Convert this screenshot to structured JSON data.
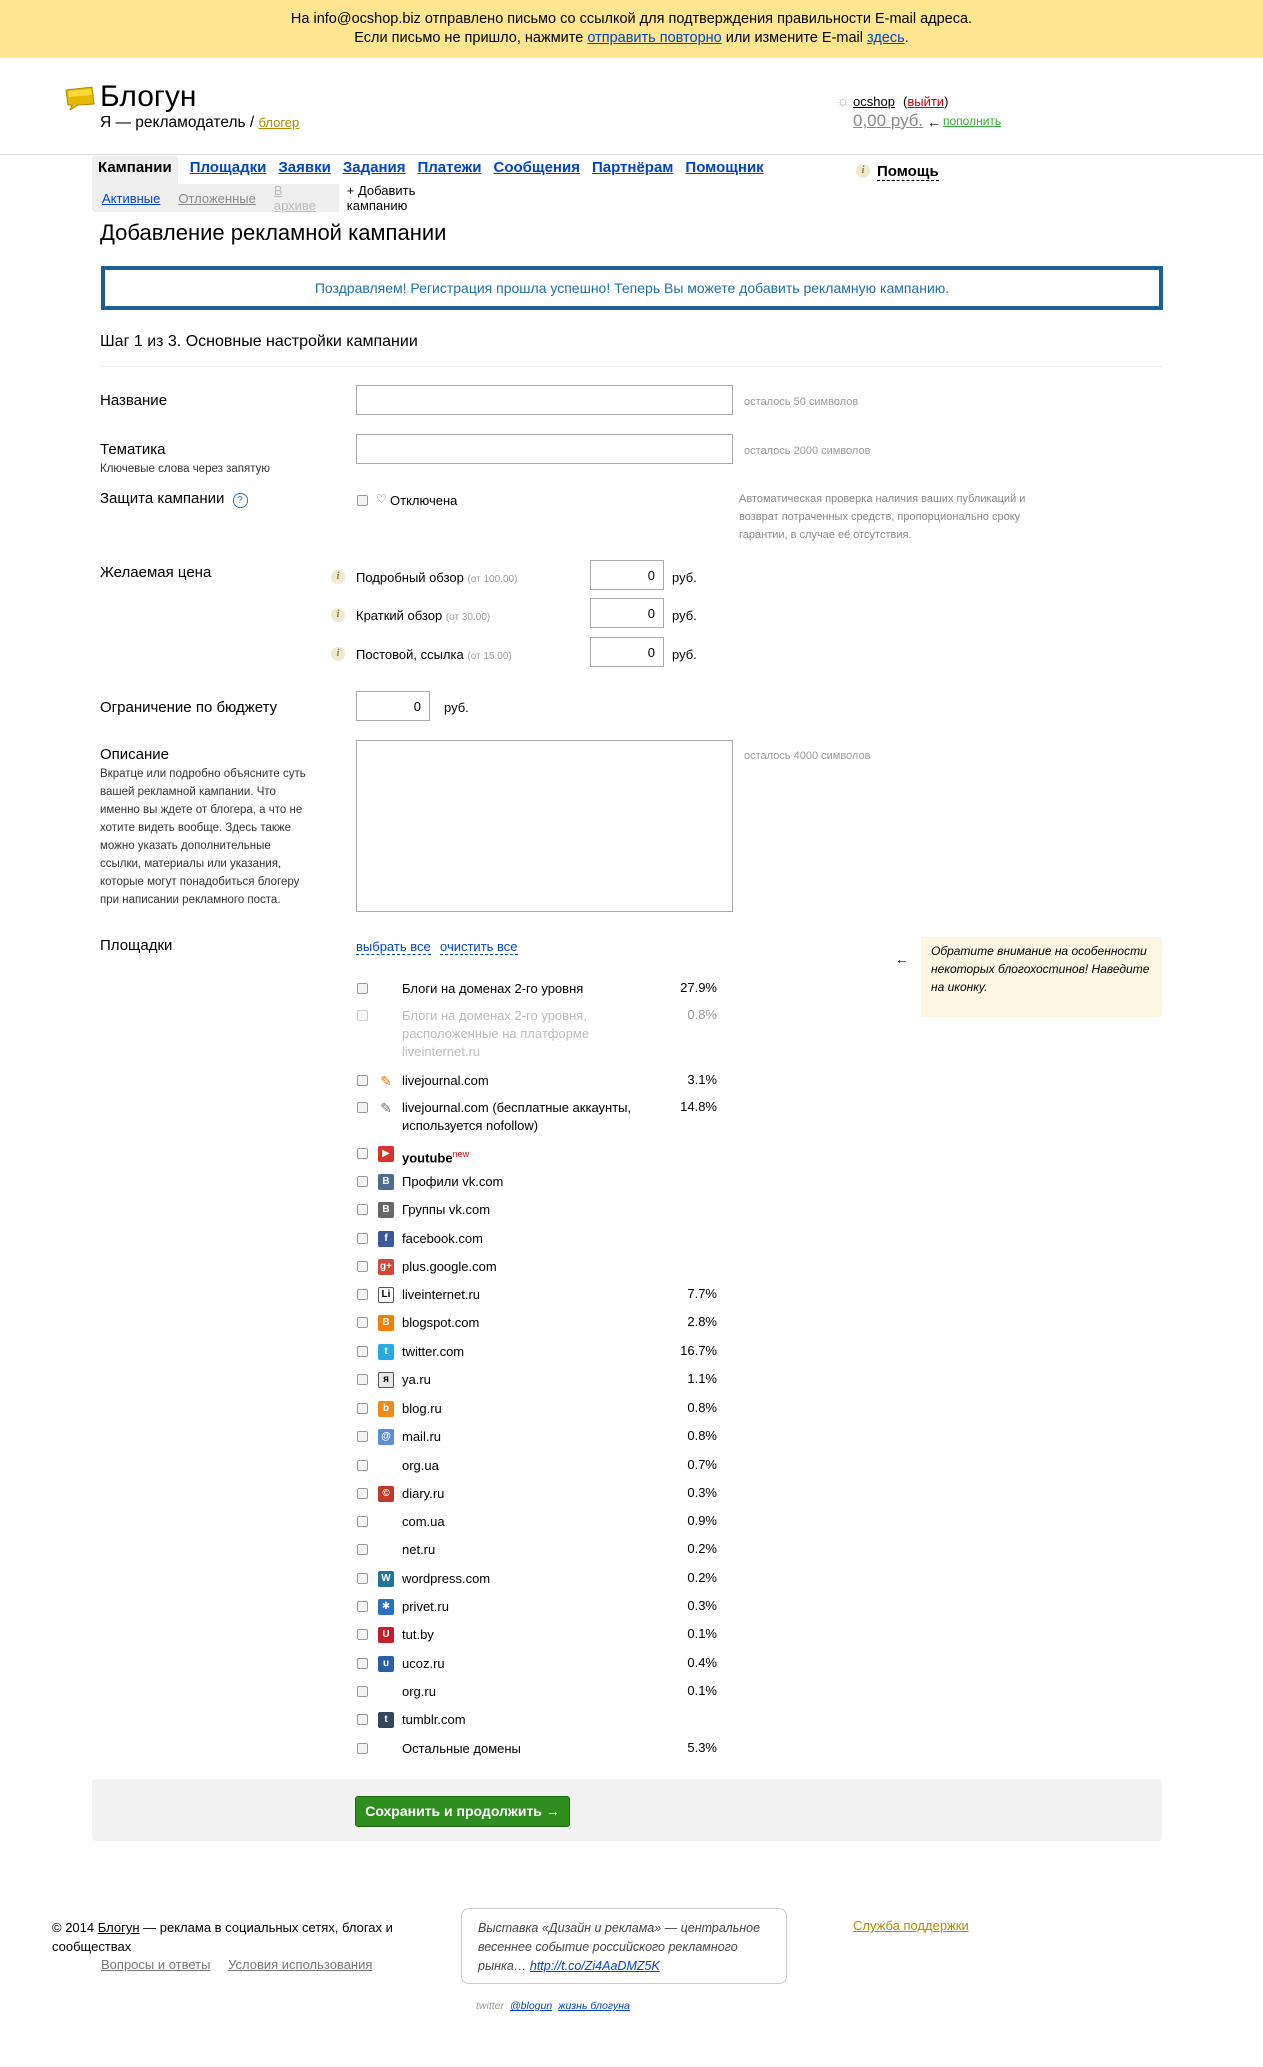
{
  "notice": {
    "line1": "На info@ocshop.biz отправлено письмо со ссылкой для подтверждения правильности E-mail адреса.",
    "line2_pre": "Если письмо не пришло, нажмите",
    "line2_link1": "отправить повторно",
    "line2_mid": "или измените E-mail",
    "line2_link2": "здесь",
    "line2_end": "."
  },
  "header": {
    "logo": "Блогун",
    "subtitle": "Я — рекламодатель /",
    "role_link": "блогер",
    "user": "ocshop",
    "logout": "выйти",
    "balance": "0,00 руб.",
    "arrow": "←",
    "topup": "пополнить"
  },
  "nav": {
    "items": [
      "Кампании",
      "Площадки",
      "Заявки",
      "Задания",
      "Платежи",
      "Сообщения",
      "Партнёрам",
      "Помощник"
    ],
    "sub": [
      "Активные",
      "Отложенные",
      "В архиве",
      "+ Добавить кампанию"
    ],
    "help": "Помощь"
  },
  "page": {
    "title": "Добавление рекламной кампании",
    "success": "Поздравляем! Регистрация прошла успешно! Теперь Вы можете добавить рекламную кампанию.",
    "step": "Шаг 1 из 3. Основные настройки кампании"
  },
  "form": {
    "name_label": "Название",
    "name_remain": "осталось 50 символов",
    "topic_label": "Тематика",
    "topic_hint": "Ключевые слова через запятую",
    "topic_remain": "осталось 2000 символов",
    "protect_label": "Защита кампании",
    "protect_value": "Отключена",
    "protect_desc": "Автоматическая проверка наличия ваших публикаций и возврат потраченных средств, пропорционально сроку гарантии, в случае её отсутствия.",
    "price_label": "Желаемая цена",
    "prices": [
      {
        "label": "Подробный обзор",
        "min": "(от 100.00)",
        "value": "0",
        "unit": "руб."
      },
      {
        "label": "Краткий обзор",
        "min": "(от 30.00)",
        "value": "0",
        "unit": "руб."
      },
      {
        "label": "Постовой, ссылка",
        "min": "(от 15.00)",
        "value": "0",
        "unit": "руб."
      }
    ],
    "budget_label": "Ограничение по бюджету",
    "budget_value": "0",
    "budget_unit": "руб.",
    "desc_label": "Описание",
    "desc_hint": "Вкратце или подробно объясните суть вашей рекламной кампании. Что именно вы ждете от блогера, а что не хотите видеть вообще. Здесь также можно указать дополнительные ссылки, материалы или указания, которые могут понадобиться блогеру при написании рекламного поста.",
    "desc_remain": "осталось 4000 символов",
    "platforms_label": "Площадки",
    "select_all": "выбрать все",
    "clear_all": "очистить все",
    "note_arrow": "←",
    "note": "Обратите внимание на особенности некоторых блогохостинов! Наведите на иконку.",
    "save": "Сохранить и продолжить →"
  },
  "platforms": [
    {
      "name": "Блоги на доменах 2-го уровня",
      "pct": "27.9%",
      "icon": "none",
      "color": ""
    },
    {
      "name": "Блоги на доменах 2-го уровня, расположенные на платформе liveinternet.ru",
      "pct": "0.8%",
      "icon": "none",
      "color": "",
      "disabled": true
    },
    {
      "name": "livejournal.com",
      "pct": "3.1%",
      "icon": "pencil-icon",
      "color": "#e07b1a"
    },
    {
      "name": "livejournal.com (бесплатные аккаунты, используется nofollow)",
      "pct": "14.8%",
      "icon": "pencil-icon",
      "color": "#777777"
    },
    {
      "name": "youtube",
      "sup": "new",
      "pct": "",
      "icon": "youtube-icon",
      "color": "#d9322a"
    },
    {
      "name": "Профили vk.com",
      "pct": "",
      "icon": "vk-icon",
      "color": "#4c6c91"
    },
    {
      "name": "Группы vk.com",
      "pct": "",
      "icon": "vk-icon",
      "color": "#666666"
    },
    {
      "name": "facebook.com",
      "pct": "",
      "icon": "facebook-icon",
      "color": "#3b5998"
    },
    {
      "name": "plus.google.com",
      "pct": "",
      "icon": "google-plus-icon",
      "color": "#d34836"
    },
    {
      "name": "liveinternet.ru",
      "pct": "7.7%",
      "icon": "liveinternet-icon",
      "color": "#ffffff"
    },
    {
      "name": "blogspot.com",
      "pct": "2.8%",
      "icon": "blogger-icon",
      "color": "#f57d00"
    },
    {
      "name": "twitter.com",
      "pct": "16.7%",
      "icon": "twitter-icon",
      "color": "#2aa9e0"
    },
    {
      "name": "ya.ru",
      "pct": "1.1%",
      "icon": "yaru-icon",
      "color": "#e8e8e8"
    },
    {
      "name": "blog.ru",
      "pct": "0.8%",
      "icon": "blogru-icon",
      "color": "#f28a1a"
    },
    {
      "name": "mail.ru",
      "pct": "0.8%",
      "icon": "mailru-icon",
      "color": "#5b8dd6"
    },
    {
      "name": "org.ua",
      "pct": "0.7%",
      "icon": "none",
      "color": ""
    },
    {
      "name": "diary.ru",
      "pct": "0.3%",
      "icon": "diary-icon",
      "color": "#c0392b"
    },
    {
      "name": "com.ua",
      "pct": "0.9%",
      "icon": "none",
      "color": ""
    },
    {
      "name": "net.ru",
      "pct": "0.2%",
      "icon": "none",
      "color": ""
    },
    {
      "name": "wordpress.com",
      "pct": "0.2%",
      "icon": "wordpress-icon",
      "color": "#21759b"
    },
    {
      "name": "privet.ru",
      "pct": "0.3%",
      "icon": "privet-icon",
      "color": "#2c6fbf"
    },
    {
      "name": "tut.by",
      "pct": "0.1%",
      "icon": "tutby-icon",
      "color": "#c41e2a"
    },
    {
      "name": "ucoz.ru",
      "pct": "0.4%",
      "icon": "ucoz-icon",
      "color": "#2d5fa8"
    },
    {
      "name": "org.ru",
      "pct": "0.1%",
      "icon": "none",
      "color": ""
    },
    {
      "name": "tumblr.com",
      "pct": "",
      "icon": "tumblr-icon",
      "color": "#35465c"
    },
    {
      "name": "Остальные домены",
      "pct": "5.3%",
      "icon": "none",
      "color": ""
    }
  ],
  "footer": {
    "year": "© 2014",
    "brand": "Блогун",
    "tagline": "— реклама в социальных сетях, блогах и сообществах",
    "links": [
      "Вопросы и ответы",
      "Условия использования"
    ],
    "tweet": "Выставка «Дизайн и реклама» — центральное весеннее событие российского рекламного рынка…",
    "tweet_link": "http://t.co/Zi4AaDMZ5K",
    "tweet_src": "twitter",
    "tweet_handle": "@blogun",
    "tweet_life": "жизнь блогуна",
    "support": "Служба поддержки"
  }
}
